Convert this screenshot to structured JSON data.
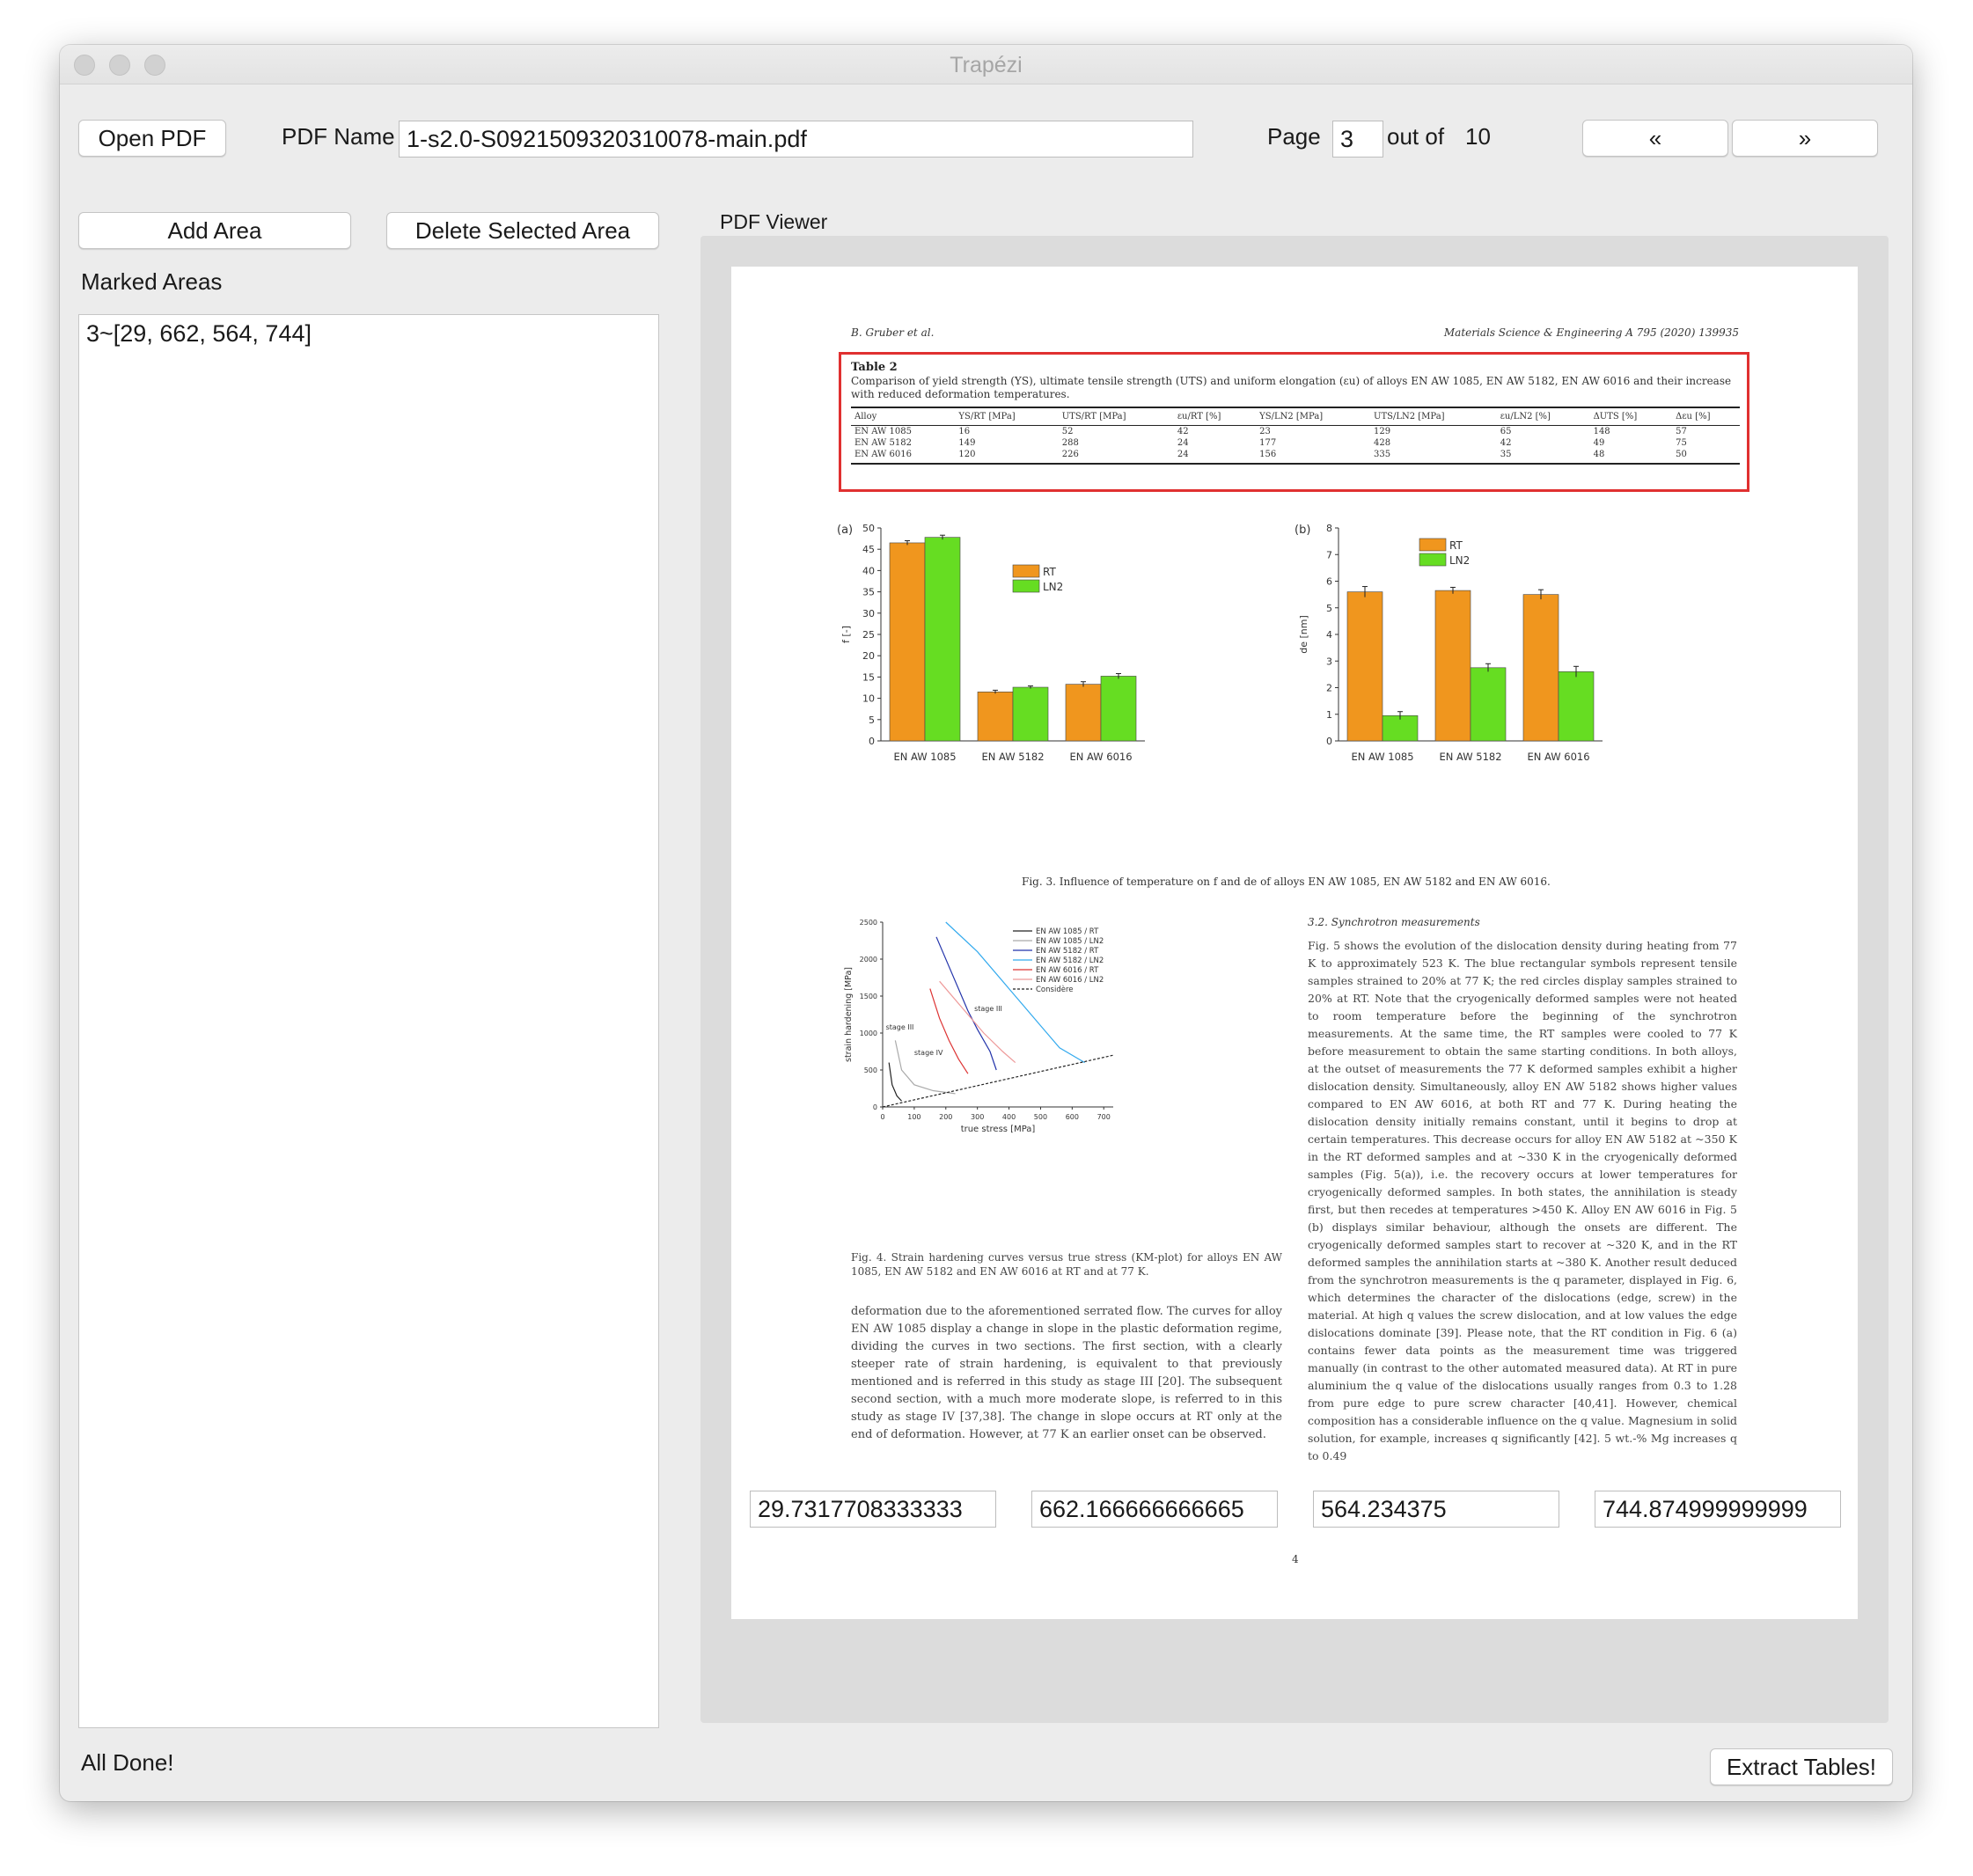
{
  "window": {
    "title": "Trapézi"
  },
  "toolbar": {
    "open_pdf_label": "Open PDF",
    "pdf_name_label": "PDF Name",
    "pdf_name_value": "1-s2.0-S0921509320310078-main.pdf",
    "page_label": "Page",
    "page_value": "3",
    "out_of_label": "out of",
    "total_pages": "10",
    "prev_label": "«",
    "next_label": "»"
  },
  "left_panel": {
    "add_area_label": "Add Area",
    "delete_area_label": "Delete Selected Area",
    "marked_areas_label": "Marked Areas",
    "marked_areas": [
      "3~[29, 662, 564, 744]"
    ]
  },
  "viewer": {
    "label": "PDF Viewer",
    "coords": [
      "29.7317708333333",
      "662.166666666665",
      "564.234375",
      "744.874999999999"
    ]
  },
  "status": {
    "text": "All Done!"
  },
  "extract_label": "Extract Tables!",
  "pdf_page": {
    "header_left": "B. Gruber et al.",
    "header_right": "Materials Science & Engineering A 795 (2020) 139935",
    "table2_title": "Table 2",
    "table2_caption": "Comparison of yield strength (YS), ultimate tensile strength (UTS) and uniform elongation (εu) of alloys EN AW 1085, EN AW 5182, EN AW 6016 and their increase with reduced deformation temperatures.",
    "table2_headers": [
      "Alloy",
      "YS/RT [MPa]",
      "UTS/RT [MPa]",
      "εu/RT [%]",
      "YS/LN2 [MPa]",
      "UTS/LN2 [MPa]",
      "εu/LN2 [%]",
      "ΔUTS [%]",
      "Δεu [%]"
    ],
    "table2_rows": [
      [
        "EN AW 1085",
        "16",
        "52",
        "42",
        "23",
        "129",
        "65",
        "148",
        "57"
      ],
      [
        "EN AW 5182",
        "149",
        "288",
        "24",
        "177",
        "428",
        "42",
        "49",
        "75"
      ],
      [
        "EN AW 6016",
        "120",
        "226",
        "24",
        "156",
        "335",
        "35",
        "48",
        "50"
      ]
    ],
    "fig3_caption": "Fig. 3. Influence of temperature on f and de of alloys EN AW 1085, EN AW 5182 and EN AW 6016.",
    "fig4_caption": "Fig. 4. Strain hardening curves versus true stress (KM-plot) for alloys EN AW 1085, EN AW 5182 and EN AW 6016 at RT and at 77 K.",
    "section_heading": "3.2. Synchrotron measurements",
    "right_text": "Fig. 5 shows the evolution of the dislocation density during heating from 77 K to approximately 523 K. The blue rectangular symbols represent tensile samples strained to 20% at 77 K; the red circles display samples strained to 20% at RT. Note that the cryogenically deformed samples were not heated to room temperature before the beginning of the synchrotron measurements. At the same time, the RT samples were cooled to 77 K before measurement to obtain the same starting conditions. In both alloys, at the outset of measurements the 77 K deformed samples exhibit a higher dislocation density. Simultaneously, alloy EN AW 5182 shows higher values compared to EN AW 6016, at both RT and 77 K. During heating the dislocation density initially remains constant, until it begins to drop at certain temperatures. This decrease occurs for alloy EN AW 5182 at ~350 K in the RT deformed samples and at ~330 K in the cryogenically deformed samples (Fig. 5(a)), i.e. the recovery occurs at lower temperatures for cryogenically deformed samples. In both states, the annihilation is steady first, but then recedes at temperatures >450 K. Alloy EN AW 6016 in Fig. 5 (b) displays similar behaviour, although the onsets are different. The cryogenically deformed samples start to recover at ~320 K, and in the RT deformed samples the annihilation starts at ~380 K. Another result deduced from the synchrotron measurements is the q parameter, displayed in Fig. 6, which determines the character of the dislocations (edge, screw) in the material. At high q values the screw dislocation, and at low values the edge dislocations dominate [39]. Please note, that the RT condition in Fig. 6 (a) contains fewer data points as the measurement time was triggered manually (in contrast to the other automated measured data). At RT in pure aluminium the q value of the dislocations usually ranges from 0.3 to 1.28 from pure edge to pure screw character [40,41]. However, chemical composition has a considerable influence on the q value. Magnesium in solid solution, for example, increases q significantly [42]. 5 wt.-% Mg increases q to 0.49",
    "left_text": "deformation due to the aforementioned serrated flow. The curves for alloy EN AW 1085 display a change in slope in the plastic deformation regime, dividing the curves in two sections. The first section, with a clearly steeper rate of strain hardening, is equivalent to that previously mentioned and is referred in this study as stage III [20]. The subsequent second section, with a much more moderate slope, is referred to in this study as stage IV [37,38]. The change in slope occurs at RT only at the end of deformation. However, at 77 K an earlier onset can be observed.",
    "page_number": "4"
  },
  "colors": {
    "rt": "#f0961e",
    "ln2": "#66dd22",
    "selection": "#e03030"
  },
  "chart_data": [
    {
      "type": "bar",
      "panel_label": "(a)",
      "categories": [
        "EN AW 1085",
        "EN AW 5182",
        "EN AW 6016"
      ],
      "series": [
        {
          "name": "RT",
          "values": [
            46.5,
            11.5,
            13.3
          ],
          "errors": [
            0.5,
            0.4,
            0.6
          ]
        },
        {
          "name": "LN2",
          "values": [
            47.8,
            12.6,
            15.2
          ],
          "errors": [
            0.5,
            0.3,
            0.6
          ]
        }
      ],
      "ylabel": "f [-]",
      "ylim": [
        0,
        50
      ],
      "yticks": [
        0,
        5,
        10,
        15,
        20,
        25,
        30,
        35,
        40,
        45,
        50
      ],
      "legend": "upper-right"
    },
    {
      "type": "bar",
      "panel_label": "(b)",
      "categories": [
        "EN AW 1085",
        "EN AW 5182",
        "EN AW 6016"
      ],
      "series": [
        {
          "name": "RT",
          "values": [
            5.6,
            5.65,
            5.5
          ],
          "errors": [
            0.2,
            0.12,
            0.18
          ]
        },
        {
          "name": "LN2",
          "values": [
            0.95,
            2.75,
            2.6
          ],
          "errors": [
            0.15,
            0.15,
            0.2
          ]
        }
      ],
      "ylabel": "de [nm]",
      "ylim": [
        0,
        8
      ],
      "yticks": [
        0,
        1,
        2,
        3,
        4,
        5,
        6,
        7,
        8
      ],
      "legend": "top-center"
    },
    {
      "type": "line",
      "xlabel": "true stress [MPa]",
      "ylabel": "strain hardening [MPa]",
      "xlim": [
        0,
        730
      ],
      "ylim": [
        0,
        2500
      ],
      "xticks": [
        0,
        100,
        200,
        300,
        400,
        500,
        600,
        700
      ],
      "yticks": [
        0,
        500,
        1000,
        1500,
        2000,
        2500
      ],
      "annotations": [
        "stage III",
        "stage IV",
        "stage III"
      ],
      "series": [
        {
          "name": "EN AW 1085 / RT",
          "color": "#222222",
          "dash": "solid",
          "points": [
            [
              20,
              600
            ],
            [
              30,
              300
            ],
            [
              45,
              150
            ],
            [
              60,
              80
            ]
          ]
        },
        {
          "name": "EN AW 1085 / LN2",
          "color": "#aaaaaa",
          "dash": "solid",
          "points": [
            [
              40,
              900
            ],
            [
              60,
              500
            ],
            [
              100,
              300
            ],
            [
              160,
              220
            ],
            [
              230,
              180
            ]
          ]
        },
        {
          "name": "EN AW 5182 / RT",
          "color": "#2233aa",
          "dash": "solid",
          "points": [
            [
              170,
              2300
            ],
            [
              220,
              1800
            ],
            [
              270,
              1300
            ],
            [
              300,
              1050
            ],
            [
              340,
              750
            ],
            [
              360,
              500
            ]
          ]
        },
        {
          "name": "EN AW 5182 / LN2",
          "color": "#33aaee",
          "dash": "solid",
          "points": [
            [
              200,
              2500
            ],
            [
              300,
              2100
            ],
            [
              400,
              1600
            ],
            [
              500,
              1100
            ],
            [
              560,
              800
            ],
            [
              640,
              600
            ]
          ]
        },
        {
          "name": "EN AW 6016 / RT",
          "color": "#dd3333",
          "dash": "solid",
          "points": [
            [
              150,
              1600
            ],
            [
              180,
              1200
            ],
            [
              210,
              900
            ],
            [
              240,
              650
            ],
            [
              270,
              450
            ]
          ]
        },
        {
          "name": "EN AW 6016 / LN2",
          "color": "#ee9999",
          "dash": "solid",
          "points": [
            [
              180,
              1700
            ],
            [
              250,
              1350
            ],
            [
              320,
              1000
            ],
            [
              380,
              750
            ],
            [
              420,
              600
            ]
          ]
        },
        {
          "name": "Considère",
          "color": "#222222",
          "dash": "dashed",
          "points": [
            [
              0,
              0
            ],
            [
              730,
              700
            ]
          ]
        }
      ]
    }
  ]
}
